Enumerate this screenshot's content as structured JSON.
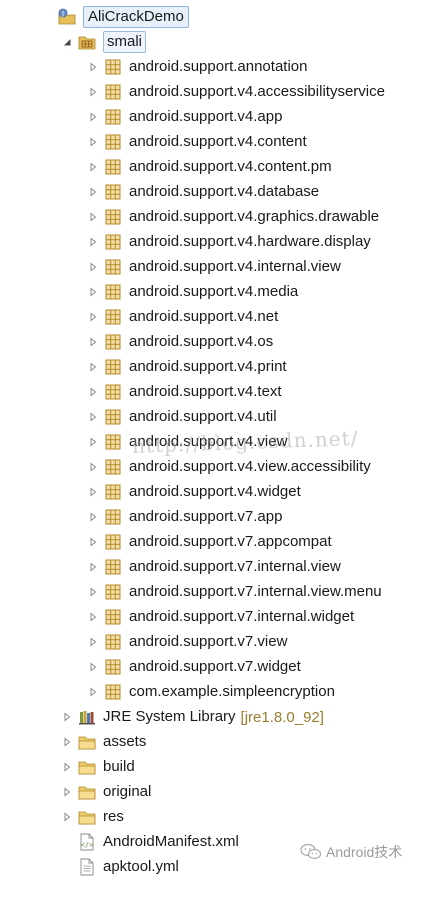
{
  "project": {
    "name": "AliCrackDemo"
  },
  "smali": {
    "name": "smali",
    "packages": [
      "android.support.annotation",
      "android.support.v4.accessibilityservice",
      "android.support.v4.app",
      "android.support.v4.content",
      "android.support.v4.content.pm",
      "android.support.v4.database",
      "android.support.v4.graphics.drawable",
      "android.support.v4.hardware.display",
      "android.support.v4.internal.view",
      "android.support.v4.media",
      "android.support.v4.net",
      "android.support.v4.os",
      "android.support.v4.print",
      "android.support.v4.text",
      "android.support.v4.util",
      "android.support.v4.view",
      "android.support.v4.view.accessibility",
      "android.support.v4.widget",
      "android.support.v7.app",
      "android.support.v7.appcompat",
      "android.support.v7.internal.view",
      "android.support.v7.internal.view.menu",
      "android.support.v7.internal.widget",
      "android.support.v7.view",
      "android.support.v7.widget",
      "com.example.simpleencryption"
    ]
  },
  "jre": {
    "name": "JRE System Library",
    "version": "[jre1.8.0_92]"
  },
  "folders": [
    "assets",
    "build",
    "original",
    "res"
  ],
  "files": [
    "AndroidManifest.xml",
    "apktool.yml"
  ],
  "watermark": "http://blog.csdn.net/",
  "brand": {
    "name": "Android技术"
  },
  "colors": {
    "folder": "#e8c05a",
    "package": "#b5892a",
    "selection": "#e8f1fb",
    "decoration": "#9a7d2e"
  }
}
